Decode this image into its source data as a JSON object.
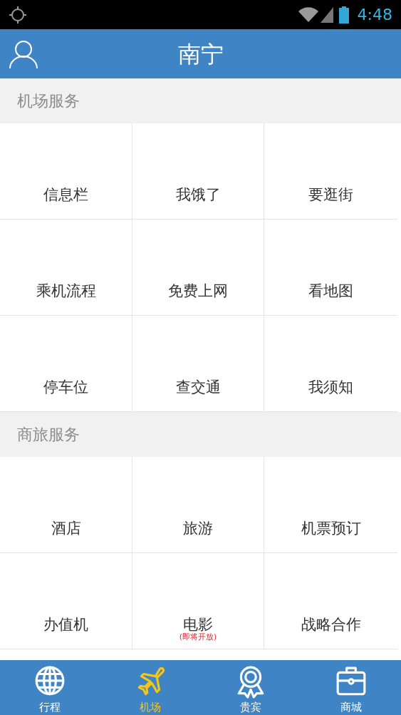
{
  "status_bar": {
    "time": "4:48"
  },
  "header": {
    "title": "南宁"
  },
  "sections": [
    {
      "title": "机场服务",
      "items": [
        {
          "label": "信息栏"
        },
        {
          "label": "我饿了"
        },
        {
          "label": "要逛街"
        },
        {
          "label": "乘机流程"
        },
        {
          "label": "免费上网"
        },
        {
          "label": "看地图"
        },
        {
          "label": "停车位"
        },
        {
          "label": "查交通"
        },
        {
          "label": "我须知"
        }
      ]
    },
    {
      "title": "商旅服务",
      "items": [
        {
          "label": "酒店"
        },
        {
          "label": "旅游"
        },
        {
          "label": "机票预订"
        },
        {
          "label": "办值机"
        },
        {
          "label": "电影",
          "note": "(即将开放)"
        },
        {
          "label": "战略合作"
        }
      ]
    }
  ],
  "tabs": [
    {
      "label": "行程",
      "selected": false
    },
    {
      "label": "机场",
      "selected": true
    },
    {
      "label": "贵宾",
      "selected": false
    },
    {
      "label": "商城",
      "selected": false
    }
  ]
}
